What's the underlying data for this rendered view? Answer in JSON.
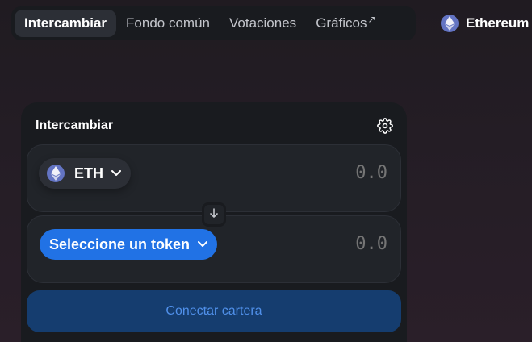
{
  "nav": {
    "items": [
      {
        "label": "Intercambiar",
        "active": true
      },
      {
        "label": "Fondo común",
        "active": false
      },
      {
        "label": "Votaciones",
        "active": false
      },
      {
        "label": "Gráficos",
        "active": false,
        "external": "↗"
      }
    ]
  },
  "network": {
    "label": "Ethereum",
    "icon": "ethereum-icon"
  },
  "swap": {
    "title": "Intercambiar",
    "settings_icon": "gear-icon",
    "input": {
      "token": "ETH",
      "token_icon": "ethereum-icon",
      "amount": "0.0"
    },
    "output": {
      "select_label": "Seleccione un token",
      "amount": "0.0"
    },
    "connect_label": "Conectar cartera"
  },
  "colors": {
    "accent": "#2172e5",
    "card_bg": "#191b1f",
    "panel_bg": "#212429",
    "connect_bg": "#153d6f",
    "connect_text": "#5090ea"
  }
}
